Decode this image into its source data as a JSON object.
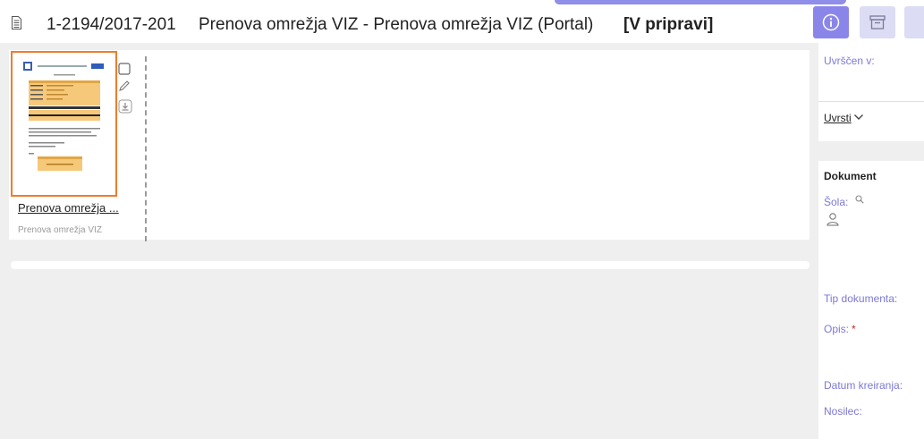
{
  "header": {
    "record_id": "1-2194/2017-201",
    "title": "Prenova omrežja VIZ - Prenova omrežja VIZ (Portal)",
    "status": "[V pripravi]"
  },
  "icons": {
    "document": "document-icon",
    "info": "info-icon",
    "archive": "archive-icon",
    "more": "more-icon",
    "edit": "edit-icon",
    "download": "download-icon",
    "select": "checkbox-icon",
    "search": "search-icon",
    "person": "person-icon",
    "chevron": "chevron-down-icon"
  },
  "documents": [
    {
      "name": "Prenova omrežja ...",
      "subtitle": "Prenova omrežja VIZ"
    }
  ],
  "right_panel": {
    "ranked_label": "Uvrščen v:",
    "rank_link": "Uvrsti",
    "section_title": "Dokument",
    "school_label": "Šola:",
    "doc_type_label": "Tip dokumenta:",
    "description_label": "Opis:",
    "required_mark": "*",
    "created_label": "Datum kreiranja:",
    "owner_label": "Nosilec:"
  },
  "colors": {
    "accent": "#8a86e9",
    "accent_light": "#dcdcf4",
    "selection": "#f07c2c",
    "label": "#7b79d8",
    "required": "#d4202a"
  }
}
